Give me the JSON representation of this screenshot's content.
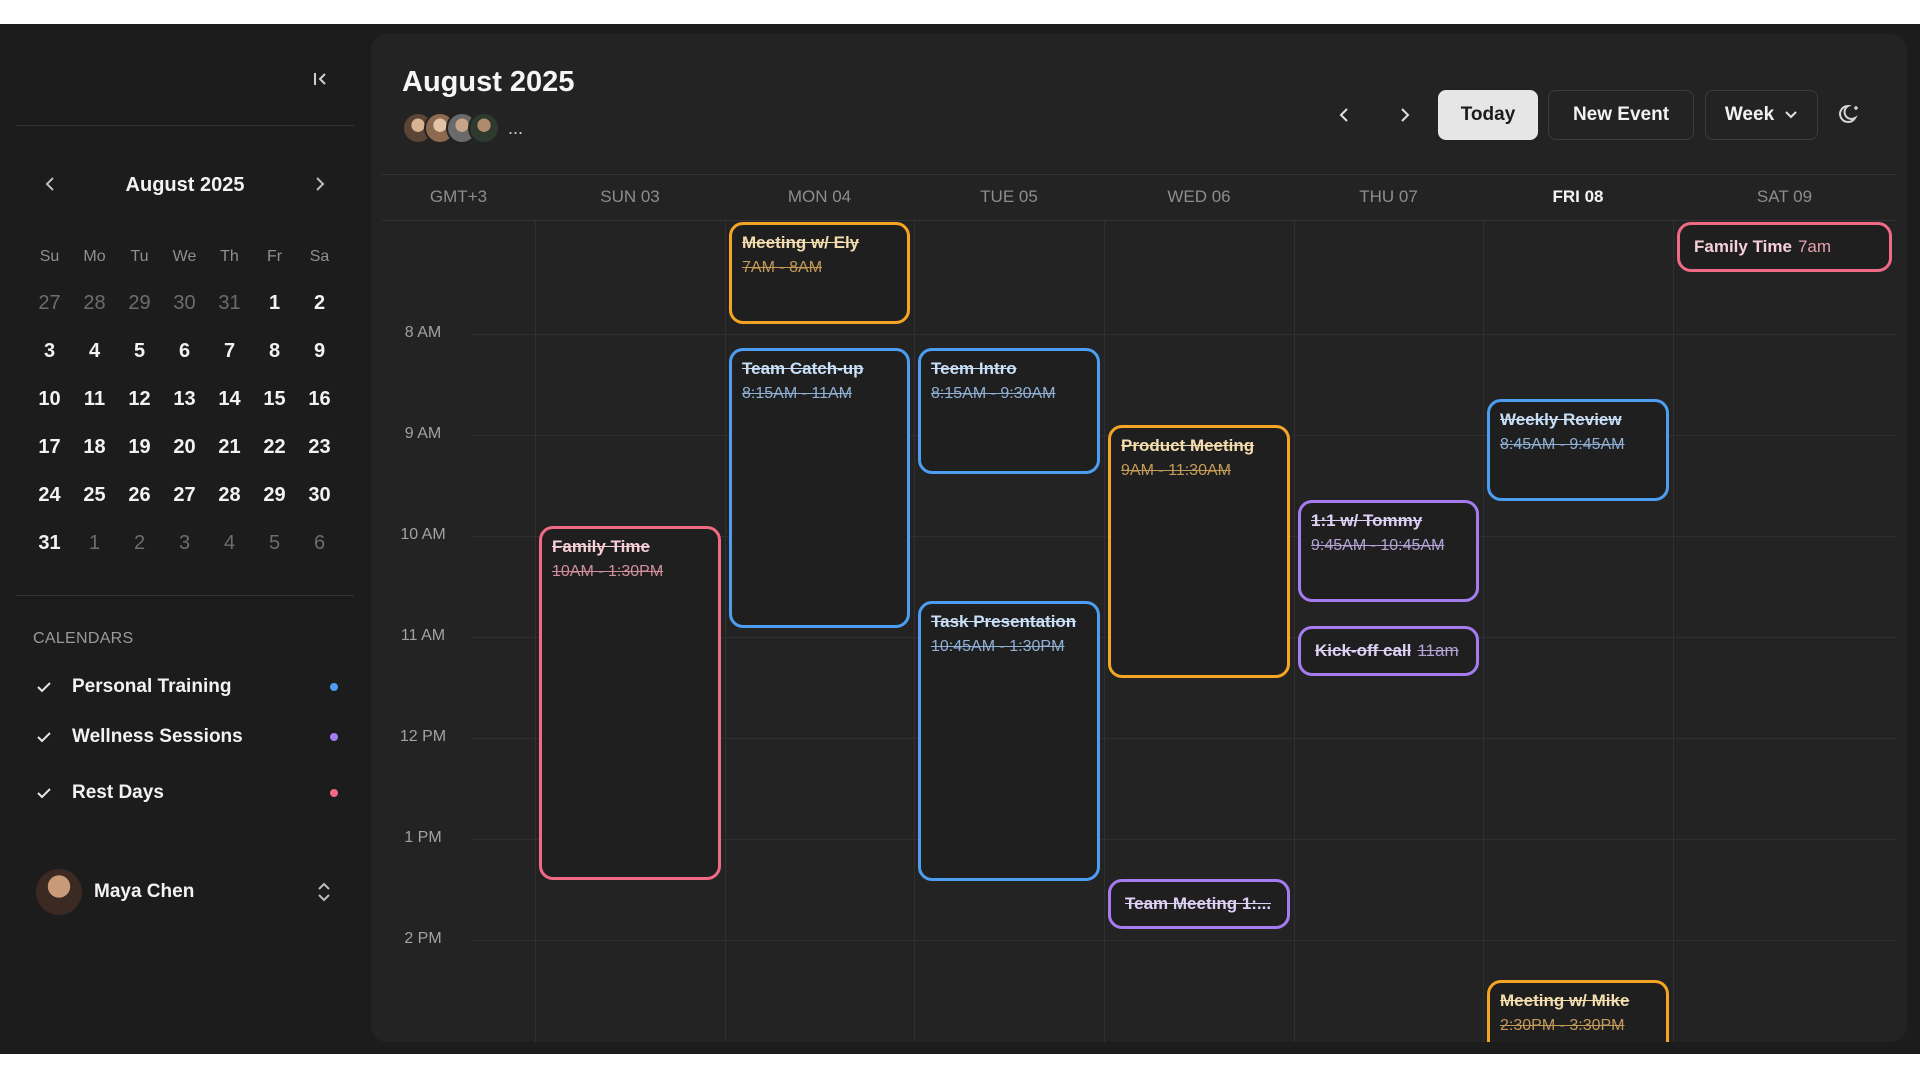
{
  "sidebar": {
    "mini_calendar": {
      "title": "August 2025",
      "weekdays": [
        "Su",
        "Mo",
        "Tu",
        "We",
        "Th",
        "Fr",
        "Sa"
      ],
      "days": [
        "27",
        "28",
        "29",
        "30",
        "31",
        "1",
        "2",
        "3",
        "4",
        "5",
        "6",
        "7",
        "8",
        "9",
        "10",
        "11",
        "12",
        "13",
        "14",
        "15",
        "16",
        "17",
        "18",
        "19",
        "20",
        "21",
        "22",
        "23",
        "24",
        "25",
        "26",
        "27",
        "28",
        "29",
        "30",
        "31",
        "1",
        "2",
        "3",
        "4",
        "5",
        "6"
      ],
      "muted_days": [
        0,
        1,
        2,
        3,
        4,
        36,
        37,
        38,
        39,
        40,
        41
      ],
      "today_index": 12
    },
    "calendars_label": "CALENDARS",
    "calendars": [
      {
        "label": "Personal Training",
        "color": "#4d9ef0"
      },
      {
        "label": "Wellness Sessions",
        "color": "#a57cf0"
      },
      {
        "label": "Rest Days",
        "color": "#f06a86"
      }
    ],
    "user": {
      "name": "Maya Chen"
    }
  },
  "header": {
    "title": "August 2025",
    "avatars_more": "...",
    "today_label": "Today",
    "new_event_label": "New Event",
    "view_label": "Week"
  },
  "week": {
    "timezone": "GMT+3",
    "days": [
      "SUN 03",
      "MON 04",
      "TUE 05",
      "WED 06",
      "THU 07",
      "FRI 08",
      "SAT 09"
    ],
    "active_day": "FRI 08",
    "hours": [
      "8 AM",
      "9 AM",
      "10 AM",
      "11 AM",
      "12 PM",
      "1 PM",
      "2 PM"
    ]
  },
  "events": [
    {
      "title": "Meeting w/ Ely",
      "time": "7AM - 8AM",
      "color": "orange"
    },
    {
      "title": "Team Catch-up",
      "time": "8:15AM - 11AM",
      "color": "blue"
    },
    {
      "title": "Teem Intro",
      "time": "8:15AM - 9:30AM",
      "color": "blue"
    },
    {
      "title": "Product Meeting",
      "time": "9AM - 11:30AM",
      "color": "orange"
    },
    {
      "title": "1:1 w/ Tommy",
      "time": "9:45AM - 10:45AM",
      "color": "purple"
    },
    {
      "title": "Weekly Review",
      "time": "8:45AM - 9:45AM",
      "color": "blue"
    },
    {
      "title": "Family Time",
      "time": "10AM - 1:30PM",
      "color": "pink"
    },
    {
      "title": "Task Presentation",
      "time": "10:45AM - 1:30PM",
      "color": "blue"
    },
    {
      "title": "Kick-off call",
      "time": "11am",
      "color": "purple"
    },
    {
      "title": "Team Meeting 1:...",
      "time": "",
      "color": "purple"
    },
    {
      "title": "Family Time",
      "time": "7am",
      "color": "pink"
    },
    {
      "title": "Meeting w/ Mike",
      "time": "2:30PM - 3:30PM",
      "color": "orange"
    }
  ]
}
